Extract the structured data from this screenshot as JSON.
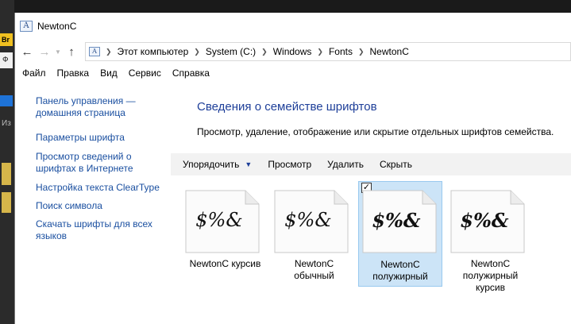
{
  "background": {
    "left_badge_1": "Br",
    "left_badge_2": "Ф",
    "left_badge_3": "Из"
  },
  "window": {
    "title": "NewtonC",
    "icon_glyph": "A"
  },
  "navigation": {
    "back_icon": "back-arrow-icon",
    "forward_icon": "forward-arrow-icon",
    "recent_icon": "chevron-down-icon",
    "up_icon": "up-arrow-icon",
    "breadcrumbs": [
      "Этот компьютер",
      "System (C:)",
      "Windows",
      "Fonts",
      "NewtonC"
    ]
  },
  "menu": {
    "items": [
      "Файл",
      "Правка",
      "Вид",
      "Сервис",
      "Справка"
    ]
  },
  "sidebar": {
    "links": [
      "Панель управления — домашняя страница",
      "Параметры шрифта",
      "Просмотр сведений о шрифтах в Интернете",
      "Настройка текста ClearType",
      "Поиск символа",
      "Скачать шрифты для всех языков"
    ]
  },
  "main": {
    "heading": "Сведения о семействе шрифтов",
    "description": "Просмотр, удаление, отображение или скрытие отдельных шрифтов семейства.",
    "toolbar": {
      "organize": "Упорядочить",
      "preview": "Просмотр",
      "delete": "Удалить",
      "hide": "Скрыть"
    },
    "fonts": [
      {
        "sample": "$%&",
        "label": "NewtonC курсив",
        "selected": false
      },
      {
        "sample": "$%&",
        "label": "NewtonC обычный",
        "selected": false
      },
      {
        "sample": "$%&",
        "label": "NewtonC полужирный",
        "selected": true
      },
      {
        "sample": "$%&",
        "label": "NewtonC полужирный курсив",
        "selected": false
      }
    ]
  },
  "colors": {
    "heading": "#1e3f99",
    "link": "#1a4fa0",
    "selection": "#cce4f7",
    "toolbar": "#f2f2f2"
  }
}
